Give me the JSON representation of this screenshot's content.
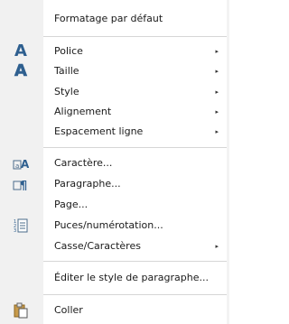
{
  "menu": {
    "items": [
      {
        "label": "Formatage par défaut",
        "arrow": ""
      },
      {
        "label": "Police",
        "arrow": "▸",
        "icon": "font-icon"
      },
      {
        "label": "Taille",
        "arrow": "▸",
        "icon": "font-size-icon"
      },
      {
        "label": "Style",
        "arrow": "▸"
      },
      {
        "label": "Alignement",
        "arrow": "▸"
      },
      {
        "label": "Espacement ligne",
        "arrow": "▸"
      },
      {
        "label": "Caractère...",
        "arrow": "",
        "icon": "character-icon"
      },
      {
        "label": "Paragraphe...",
        "arrow": "",
        "icon": "paragraph-icon"
      },
      {
        "label": "Page...",
        "arrow": ""
      },
      {
        "label": "Puces/numérotation...",
        "arrow": "",
        "icon": "bullets-numbering-icon"
      },
      {
        "label": "Casse/Caractères",
        "arrow": "▸"
      },
      {
        "label": "Éditer le style de paragraphe...",
        "arrow": ""
      },
      {
        "label": "Coller",
        "arrow": "",
        "icon": "paste-icon"
      }
    ]
  },
  "colors": {
    "icon_blue": "#2e5f8f",
    "icon_column": "#f1f1f1"
  }
}
